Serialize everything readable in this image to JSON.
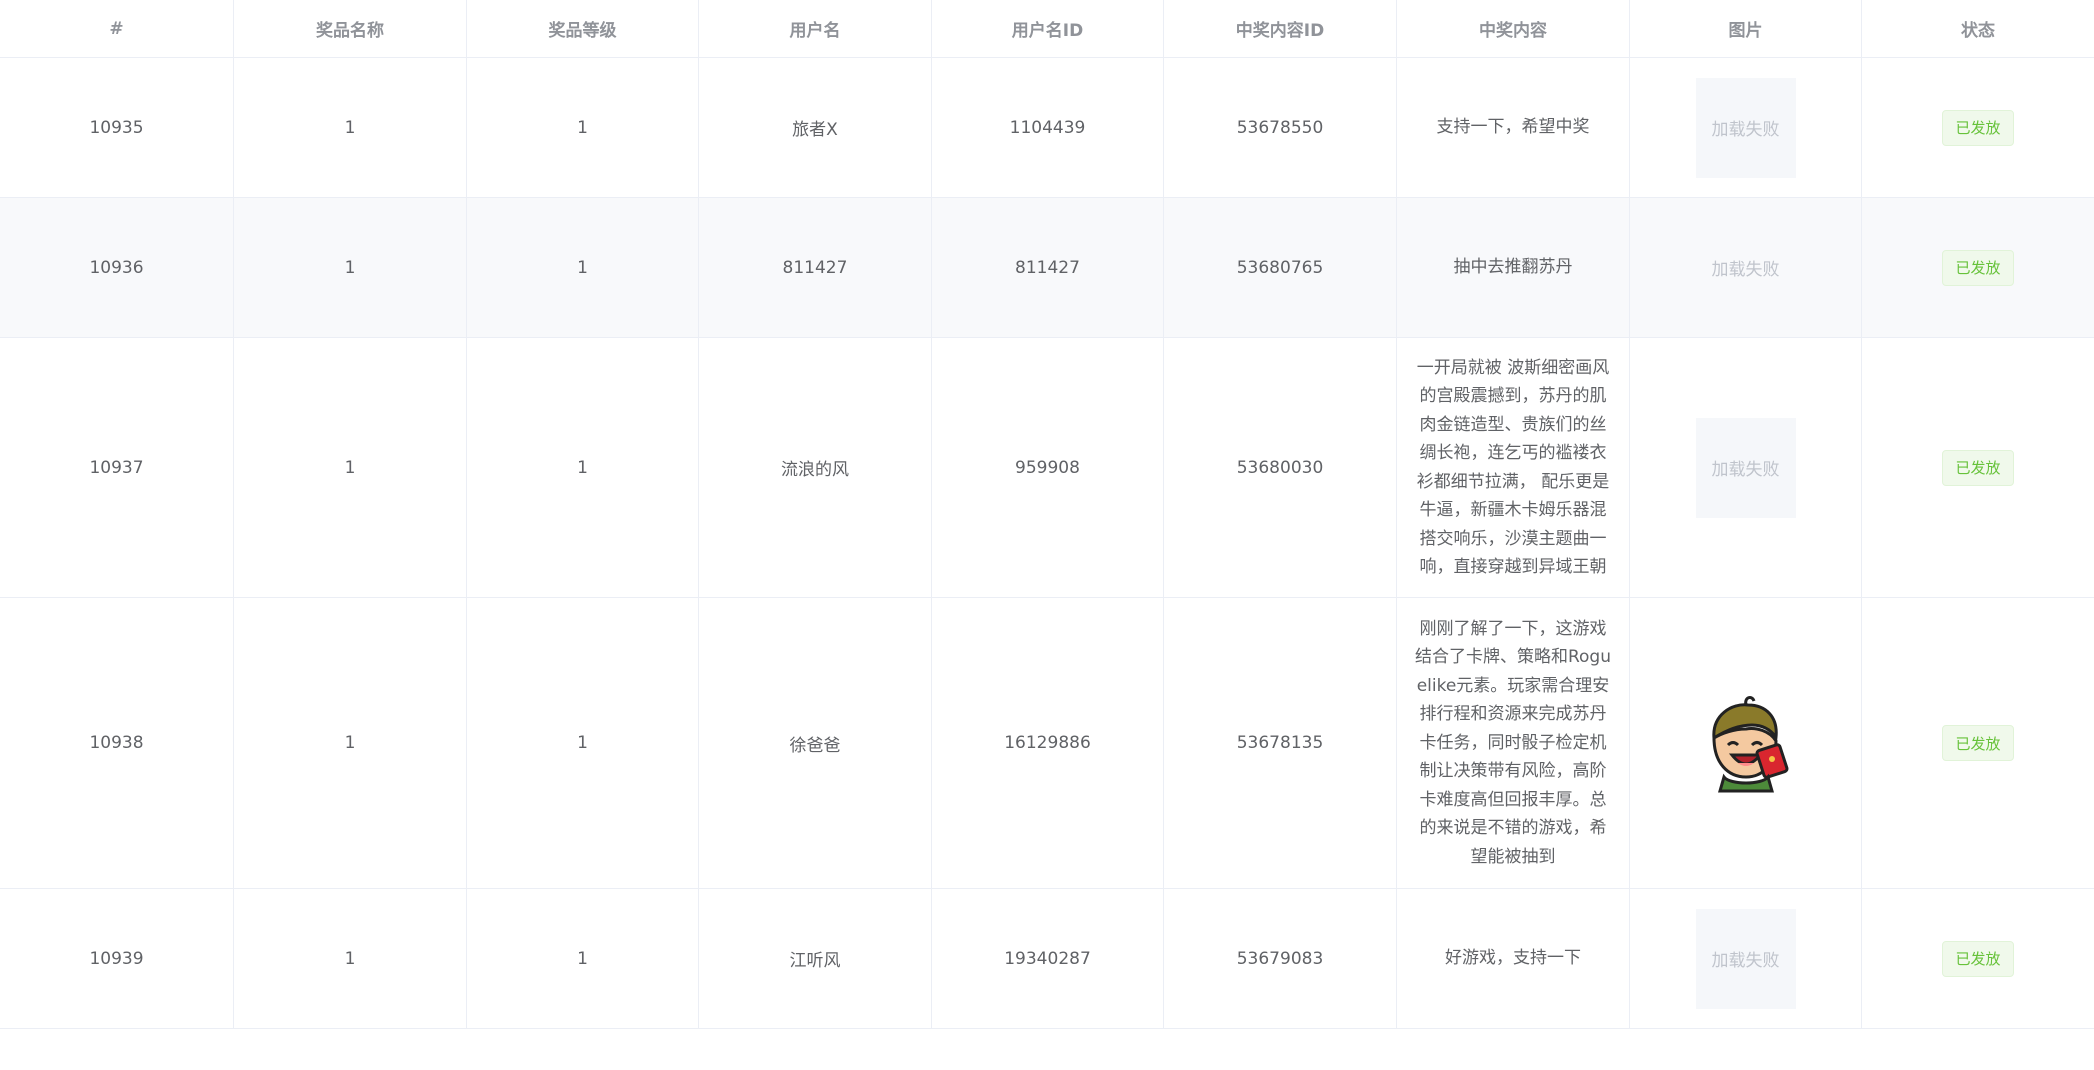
{
  "table": {
    "headers": [
      "#",
      "奖品名称",
      "奖品等级",
      "用户名",
      "用户名ID",
      "中奖内容ID",
      "中奖内容",
      "图片",
      "状态"
    ],
    "rows": [
      {
        "id": "10935",
        "prize_name": "1",
        "prize_level": "1",
        "username": "旅者X",
        "user_id": "1104439",
        "content_id": "53678550",
        "content": "支持一下，希望中奖",
        "image": "加载失败",
        "status": "已发放"
      },
      {
        "id": "10936",
        "prize_name": "1",
        "prize_level": "1",
        "username": "811427",
        "user_id": "811427",
        "content_id": "53680765",
        "content": "抽中去推翻苏丹",
        "image": "加载失败",
        "status": "已发放"
      },
      {
        "id": "10937",
        "prize_name": "1",
        "prize_level": "1",
        "username": "流浪的风",
        "user_id": "959908",
        "content_id": "53680030",
        "content": "一开局就被 波斯细密画风的宫殿震撼到，苏丹的肌肉金链造型、贵族们的丝绸长袍，连乞丐的褴褛衣衫都细节拉满， 配乐更是牛逼，新疆木卡姆乐器混搭交响乐，沙漠主题曲一响，直接穿越到异域王朝",
        "image": "加载失败",
        "status": "已发放"
      },
      {
        "id": "10938",
        "prize_name": "1",
        "prize_level": "1",
        "username": "徐爸爸",
        "user_id": "16129886",
        "content_id": "53678135",
        "content": "刚刚了解了一下，这游戏结合了卡牌、策略和Roguelike元素。玩家需合理安排行程和资源来完成苏丹卡任务，同时骰子检定机制让决策带有风险，高阶卡难度高但回报丰厚。总的来说是不错的游戏，希望能被抽到",
        "image_icon": "cartoon-avatar-icon",
        "status": "已发放"
      },
      {
        "id": "10939",
        "prize_name": "1",
        "prize_level": "1",
        "username": "江听风",
        "user_id": "19340287",
        "content_id": "53679083",
        "content": "好游戏，支持一下",
        "image": "加载失败",
        "status": "已发放"
      }
    ]
  },
  "colors": {
    "header_text": "#909399",
    "body_text": "#606266",
    "border": "#ebeef5",
    "striped_bg": "#f8f9fb",
    "status_green": "#67c23a",
    "status_bg": "#f0f9eb",
    "img_fail_bg": "#f5f7fa",
    "img_fail_text": "#c0c4cc"
  }
}
